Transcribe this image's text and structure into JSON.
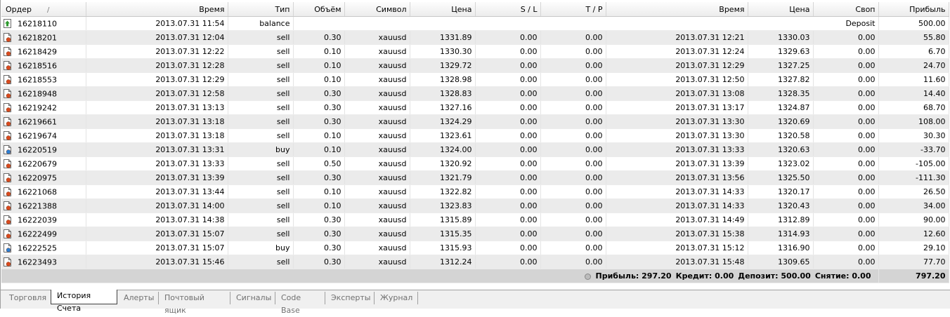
{
  "columns": [
    "Ордер",
    "Время",
    "Тип",
    "Объём",
    "Символ",
    "Цена",
    "S / L",
    "T / P",
    "Время",
    "Цена",
    "Своп",
    "Прибыль"
  ],
  "sort_indicator": "/",
  "balance_row": {
    "order": "16218110",
    "time": "2013.07.31 11:54",
    "type": "balance",
    "comment": "Deposit",
    "profit": "500.00",
    "icon": "balance-arrow-icon"
  },
  "deals": [
    {
      "order": "16218201",
      "open_time": "2013.07.31 12:04",
      "type": "sell",
      "volume": "0.30",
      "symbol": "xauusd",
      "open_price": "1331.89",
      "sl": "0.00",
      "tp": "0.00",
      "close_time": "2013.07.31 12:21",
      "close_price": "1330.03",
      "swap": "0.00",
      "profit": "55.80"
    },
    {
      "order": "16218429",
      "open_time": "2013.07.31 12:22",
      "type": "sell",
      "volume": "0.10",
      "symbol": "xauusd",
      "open_price": "1330.30",
      "sl": "0.00",
      "tp": "0.00",
      "close_time": "2013.07.31 12:24",
      "close_price": "1329.63",
      "swap": "0.00",
      "profit": "6.70"
    },
    {
      "order": "16218516",
      "open_time": "2013.07.31 12:28",
      "type": "sell",
      "volume": "0.10",
      "symbol": "xauusd",
      "open_price": "1329.72",
      "sl": "0.00",
      "tp": "0.00",
      "close_time": "2013.07.31 12:29",
      "close_price": "1327.25",
      "swap": "0.00",
      "profit": "24.70"
    },
    {
      "order": "16218553",
      "open_time": "2013.07.31 12:29",
      "type": "sell",
      "volume": "0.10",
      "symbol": "xauusd",
      "open_price": "1328.98",
      "sl": "0.00",
      "tp": "0.00",
      "close_time": "2013.07.31 12:50",
      "close_price": "1327.82",
      "swap": "0.00",
      "profit": "11.60"
    },
    {
      "order": "16218948",
      "open_time": "2013.07.31 12:58",
      "type": "sell",
      "volume": "0.30",
      "symbol": "xauusd",
      "open_price": "1328.83",
      "sl": "0.00",
      "tp": "0.00",
      "close_time": "2013.07.31 13:08",
      "close_price": "1328.35",
      "swap": "0.00",
      "profit": "14.40"
    },
    {
      "order": "16219242",
      "open_time": "2013.07.31 13:13",
      "type": "sell",
      "volume": "0.30",
      "symbol": "xauusd",
      "open_price": "1327.16",
      "sl": "0.00",
      "tp": "0.00",
      "close_time": "2013.07.31 13:17",
      "close_price": "1324.87",
      "swap": "0.00",
      "profit": "68.70"
    },
    {
      "order": "16219661",
      "open_time": "2013.07.31 13:18",
      "type": "sell",
      "volume": "0.30",
      "symbol": "xauusd",
      "open_price": "1324.29",
      "sl": "0.00",
      "tp": "0.00",
      "close_time": "2013.07.31 13:30",
      "close_price": "1320.69",
      "swap": "0.00",
      "profit": "108.00"
    },
    {
      "order": "16219674",
      "open_time": "2013.07.31 13:18",
      "type": "sell",
      "volume": "0.10",
      "symbol": "xauusd",
      "open_price": "1323.61",
      "sl": "0.00",
      "tp": "0.00",
      "close_time": "2013.07.31 13:30",
      "close_price": "1320.58",
      "swap": "0.00",
      "profit": "30.30"
    },
    {
      "order": "16220519",
      "open_time": "2013.07.31 13:31",
      "type": "buy",
      "volume": "0.10",
      "symbol": "xauusd",
      "open_price": "1324.00",
      "sl": "0.00",
      "tp": "0.00",
      "close_time": "2013.07.31 13:33",
      "close_price": "1320.63",
      "swap": "0.00",
      "profit": "-33.70"
    },
    {
      "order": "16220679",
      "open_time": "2013.07.31 13:33",
      "type": "sell",
      "volume": "0.50",
      "symbol": "xauusd",
      "open_price": "1320.92",
      "sl": "0.00",
      "tp": "0.00",
      "close_time": "2013.07.31 13:39",
      "close_price": "1323.02",
      "swap": "0.00",
      "profit": "-105.00"
    },
    {
      "order": "16220975",
      "open_time": "2013.07.31 13:39",
      "type": "sell",
      "volume": "0.30",
      "symbol": "xauusd",
      "open_price": "1321.79",
      "sl": "0.00",
      "tp": "0.00",
      "close_time": "2013.07.31 13:56",
      "close_price": "1325.50",
      "swap": "0.00",
      "profit": "-111.30"
    },
    {
      "order": "16221068",
      "open_time": "2013.07.31 13:44",
      "type": "sell",
      "volume": "0.10",
      "symbol": "xauusd",
      "open_price": "1322.82",
      "sl": "0.00",
      "tp": "0.00",
      "close_time": "2013.07.31 14:33",
      "close_price": "1320.17",
      "swap": "0.00",
      "profit": "26.50"
    },
    {
      "order": "16221388",
      "open_time": "2013.07.31 14:00",
      "type": "sell",
      "volume": "0.10",
      "symbol": "xauusd",
      "open_price": "1323.83",
      "sl": "0.00",
      "tp": "0.00",
      "close_time": "2013.07.31 14:33",
      "close_price": "1320.43",
      "swap": "0.00",
      "profit": "34.00"
    },
    {
      "order": "16222039",
      "open_time": "2013.07.31 14:38",
      "type": "sell",
      "volume": "0.30",
      "symbol": "xauusd",
      "open_price": "1315.89",
      "sl": "0.00",
      "tp": "0.00",
      "close_time": "2013.07.31 14:49",
      "close_price": "1312.89",
      "swap": "0.00",
      "profit": "90.00"
    },
    {
      "order": "16222499",
      "open_time": "2013.07.31 15:07",
      "type": "sell",
      "volume": "0.30",
      "symbol": "xauusd",
      "open_price": "1315.35",
      "sl": "0.00",
      "tp": "0.00",
      "close_time": "2013.07.31 15:38",
      "close_price": "1314.93",
      "swap": "0.00",
      "profit": "12.60"
    },
    {
      "order": "16222525",
      "open_time": "2013.07.31 15:07",
      "type": "buy",
      "volume": "0.30",
      "symbol": "xauusd",
      "open_price": "1315.93",
      "sl": "0.00",
      "tp": "0.00",
      "close_time": "2013.07.31 15:12",
      "close_price": "1316.90",
      "swap": "0.00",
      "profit": "29.10"
    },
    {
      "order": "16223493",
      "open_time": "2013.07.31 15:46",
      "type": "sell",
      "volume": "0.30",
      "symbol": "xauusd",
      "open_price": "1312.24",
      "sl": "0.00",
      "tp": "0.00",
      "close_time": "2013.07.31 15:48",
      "close_price": "1309.65",
      "swap": "0.00",
      "profit": "77.70"
    }
  ],
  "summary": {
    "profit": "Прибыль: 297.20",
    "credit": "Кредит: 0.00",
    "deposit": "Депозит: 500.00",
    "withdrawal": "Снятие: 0.00",
    "total": "797.20"
  },
  "tabs": [
    {
      "label": "Торговля",
      "active": false
    },
    {
      "label": "История Счета",
      "active": true
    },
    {
      "label": "Алерты",
      "active": false
    },
    {
      "label": "Почтовый ящик",
      "active": false
    },
    {
      "label": "Сигналы",
      "active": false
    },
    {
      "label": "Code Base",
      "active": false
    },
    {
      "label": "Эксперты",
      "active": false
    },
    {
      "label": "Журнал",
      "active": false
    }
  ],
  "colors": {
    "sell_icon_dot": "#d94a1f",
    "buy_icon_dot": "#2b7fd4",
    "balance_icon": "#2e9a2e"
  }
}
